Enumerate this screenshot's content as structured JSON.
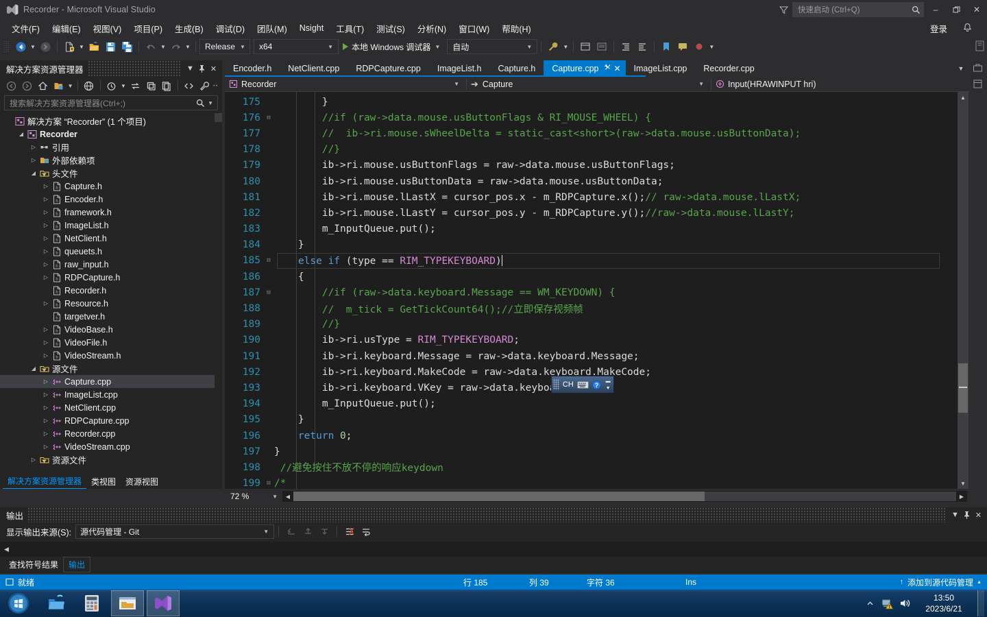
{
  "window": {
    "title": "Recorder - Microsoft Visual Studio",
    "logo_icon": "visual-studio-logo",
    "minimize": "–",
    "maximize": "❐",
    "close": "✕",
    "filter_icon": "filter-icon"
  },
  "quick_launch": {
    "placeholder": "快速启动 (Ctrl+Q)",
    "search_icon": "search-icon"
  },
  "menu": {
    "items": [
      "文件(F)",
      "编辑(E)",
      "视图(V)",
      "项目(P)",
      "生成(B)",
      "调试(D)",
      "团队(M)",
      "Nsight",
      "工具(T)",
      "测试(S)",
      "分析(N)",
      "窗口(W)",
      "帮助(H)"
    ],
    "signin": "登录",
    "notification_icon": "bell-icon"
  },
  "toolbar": {
    "nav_back_icon": "navigate-back-icon",
    "nav_forward_icon": "navigate-forward-icon",
    "new_item_icon": "new-item-icon",
    "open_icon": "open-folder-icon",
    "save_icon": "save-icon",
    "save_all_icon": "save-all-icon",
    "undo_icon": "undo-icon",
    "redo_icon": "redo-icon",
    "configuration": "Release",
    "platform": "x64",
    "run_label": "本地 Windows 调试器",
    "run_icon": "play-icon",
    "auto": "自动",
    "extra_icons": [
      "wrench-icon",
      "layout-icon",
      "list-icon",
      "indent-icon",
      "outdent-icon",
      "comment-icon",
      "bookmark-icon",
      "breakpoint-icon"
    ]
  },
  "solution_explorer": {
    "title": "解决方案资源管理器",
    "caret_icon": "chevron-down-icon",
    "pin_icon": "pin-icon",
    "close_icon": "close-icon",
    "toolbar_icons": [
      "back-icon",
      "forward-icon",
      "home-icon",
      "pending-changes-icon",
      "sync-icon",
      "refresh-icon",
      "collapse-all-icon",
      "properties-icon",
      "show-all-files-icon",
      "code-view-icon",
      "wrench-icon"
    ],
    "search_placeholder": "搜索解决方案资源管理器(Ctrl+;)",
    "search_icon": "search-icon",
    "tree": [
      {
        "label": "解决方案 “Recorder” (1 个项目)",
        "indent": 0,
        "expander": "",
        "icon": "solution-icon",
        "bold": false,
        "selected": false
      },
      {
        "label": "Recorder",
        "indent": 1,
        "expander": "◢",
        "icon": "project-icon",
        "bold": true,
        "selected": false
      },
      {
        "label": "引用",
        "indent": 2,
        "expander": "▷",
        "icon": "references-icon",
        "bold": false,
        "selected": false
      },
      {
        "label": "外部依赖项",
        "indent": 2,
        "expander": "▷",
        "icon": "folder-icon",
        "bold": false,
        "selected": false
      },
      {
        "label": "头文件",
        "indent": 2,
        "expander": "◢",
        "icon": "filter-folder-icon",
        "bold": false,
        "selected": false
      },
      {
        "label": "Capture.h",
        "indent": 3,
        "expander": "▷",
        "icon": "header-file-icon",
        "bold": false,
        "selected": false
      },
      {
        "label": "Encoder.h",
        "indent": 3,
        "expander": "▷",
        "icon": "header-file-icon",
        "bold": false,
        "selected": false
      },
      {
        "label": "framework.h",
        "indent": 3,
        "expander": "▷",
        "icon": "header-file-icon",
        "bold": false,
        "selected": false
      },
      {
        "label": "ImageList.h",
        "indent": 3,
        "expander": "▷",
        "icon": "header-file-icon",
        "bold": false,
        "selected": false
      },
      {
        "label": "NetClient.h",
        "indent": 3,
        "expander": "▷",
        "icon": "header-file-icon",
        "bold": false,
        "selected": false
      },
      {
        "label": "queuets.h",
        "indent": 3,
        "expander": "▷",
        "icon": "header-file-icon",
        "bold": false,
        "selected": false
      },
      {
        "label": "raw_input.h",
        "indent": 3,
        "expander": "▷",
        "icon": "header-file-icon",
        "bold": false,
        "selected": false
      },
      {
        "label": "RDPCapture.h",
        "indent": 3,
        "expander": "▷",
        "icon": "header-file-icon",
        "bold": false,
        "selected": false
      },
      {
        "label": "Recorder.h",
        "indent": 3,
        "expander": "",
        "icon": "header-file-icon",
        "bold": false,
        "selected": false
      },
      {
        "label": "Resource.h",
        "indent": 3,
        "expander": "▷",
        "icon": "header-file-icon",
        "bold": false,
        "selected": false
      },
      {
        "label": "targetver.h",
        "indent": 3,
        "expander": "",
        "icon": "header-file-icon",
        "bold": false,
        "selected": false
      },
      {
        "label": "VideoBase.h",
        "indent": 3,
        "expander": "▷",
        "icon": "header-file-icon",
        "bold": false,
        "selected": false
      },
      {
        "label": "VideoFile.h",
        "indent": 3,
        "expander": "▷",
        "icon": "header-file-icon",
        "bold": false,
        "selected": false
      },
      {
        "label": "VideoStream.h",
        "indent": 3,
        "expander": "▷",
        "icon": "header-file-icon",
        "bold": false,
        "selected": false
      },
      {
        "label": "源文件",
        "indent": 2,
        "expander": "◢",
        "icon": "filter-folder-icon",
        "bold": false,
        "selected": false
      },
      {
        "label": "Capture.cpp",
        "indent": 3,
        "expander": "▷",
        "icon": "cpp-file-icon",
        "bold": false,
        "selected": true
      },
      {
        "label": "ImageList.cpp",
        "indent": 3,
        "expander": "▷",
        "icon": "cpp-file-icon",
        "bold": false,
        "selected": false
      },
      {
        "label": "NetClient.cpp",
        "indent": 3,
        "expander": "▷",
        "icon": "cpp-file-icon",
        "bold": false,
        "selected": false
      },
      {
        "label": "RDPCapture.cpp",
        "indent": 3,
        "expander": "▷",
        "icon": "cpp-file-icon",
        "bold": false,
        "selected": false
      },
      {
        "label": "Recorder.cpp",
        "indent": 3,
        "expander": "▷",
        "icon": "cpp-file-icon",
        "bold": false,
        "selected": false
      },
      {
        "label": "VideoStream.cpp",
        "indent": 3,
        "expander": "▷",
        "icon": "cpp-file-icon",
        "bold": false,
        "selected": false
      },
      {
        "label": "资源文件",
        "indent": 2,
        "expander": "▷",
        "icon": "filter-folder-icon",
        "bold": false,
        "selected": false
      }
    ],
    "bottom_tabs": [
      {
        "label": "解决方案资源管理器",
        "active": true
      },
      {
        "label": "类视图",
        "active": false
      },
      {
        "label": "资源视图",
        "active": false
      }
    ]
  },
  "editor": {
    "tabs": [
      {
        "label": "Encoder.h",
        "active": false
      },
      {
        "label": "NetClient.cpp",
        "active": false
      },
      {
        "label": "RDPCapture.cpp",
        "active": false
      },
      {
        "label": "ImageList.h",
        "active": false
      },
      {
        "label": "Capture.h",
        "active": false
      },
      {
        "label": "Capture.cpp",
        "active": true
      },
      {
        "label": "ImageList.cpp",
        "active": false
      },
      {
        "label": "Recorder.cpp",
        "active": false
      }
    ],
    "tab_pin_icon": "pin-icon",
    "tab_close_icon": "close-icon",
    "tab_overflow_icon": "chevron-down-icon",
    "nav": {
      "project": "Recorder",
      "project_icon": "project-icon",
      "class": "Capture",
      "class_icon": "class-arrow-icon",
      "member": "Input(HRAWINPUT hri)",
      "member_icon": "method-icon",
      "caret_icon": "chevron-down-icon"
    },
    "zoom": "72 %",
    "zoom_caret_icon": "chevron-down-icon",
    "lines": [
      {
        "n": "175",
        "fold": "",
        "cur": false,
        "parts": [
          {
            "t": "        }",
            "c": ""
          }
        ]
      },
      {
        "n": "176",
        "fold": "⊟",
        "cur": false,
        "parts": [
          {
            "t": "        //if (raw->data.mouse.usButtonFlags & RI_MOUSE_WHEEL) {",
            "c": "cm"
          }
        ]
      },
      {
        "n": "177",
        "fold": "",
        "cur": false,
        "parts": [
          {
            "t": "        //  ib->ri.mouse.sWheelDelta = static_cast<short>(raw->data.mouse.usButtonData);",
            "c": "cm"
          }
        ]
      },
      {
        "n": "178",
        "fold": "",
        "cur": false,
        "parts": [
          {
            "t": "        //}",
            "c": "cm"
          }
        ]
      },
      {
        "n": "179",
        "fold": "",
        "cur": false,
        "parts": [
          {
            "t": "        ib->ri.mouse.usButtonFlags = raw->data.mouse.usButtonFlags;",
            "c": ""
          }
        ]
      },
      {
        "n": "180",
        "fold": "",
        "cur": false,
        "parts": [
          {
            "t": "        ib->ri.mouse.usButtonData = raw->data.mouse.usButtonData;",
            "c": ""
          }
        ]
      },
      {
        "n": "181",
        "fold": "",
        "cur": false,
        "parts": [
          {
            "t": "        ib->ri.mouse.lLastX = cursor_pos.x - m_RDPCapture.x();",
            "c": ""
          },
          {
            "t": "// raw->data.mouse.lLastX;",
            "c": "cm"
          }
        ]
      },
      {
        "n": "182",
        "fold": "",
        "cur": false,
        "parts": [
          {
            "t": "        ib->ri.mouse.lLastY = cursor_pos.y - m_RDPCapture.y();",
            "c": ""
          },
          {
            "t": "//raw->data.mouse.lLastY;",
            "c": "cm"
          }
        ]
      },
      {
        "n": "183",
        "fold": "",
        "cur": false,
        "parts": [
          {
            "t": "        m_InputQueue.put();",
            "c": ""
          }
        ]
      },
      {
        "n": "184",
        "fold": "",
        "cur": false,
        "parts": [
          {
            "t": "    }",
            "c": ""
          }
        ]
      },
      {
        "n": "185",
        "fold": "⊟",
        "cur": true,
        "parts": [
          {
            "t": "    ",
            "c": ""
          },
          {
            "t": "else if",
            "c": "kw"
          },
          {
            "t": " (type == ",
            "c": ""
          },
          {
            "t": "RIM_TYPEKEYBOARD",
            "c": "mac"
          },
          {
            "t": ")",
            "c": ""
          }
        ]
      },
      {
        "n": "186",
        "fold": "",
        "cur": false,
        "parts": [
          {
            "t": "    {",
            "c": ""
          }
        ]
      },
      {
        "n": "187",
        "fold": "⊟",
        "cur": false,
        "parts": [
          {
            "t": "        //if (raw->data.keyboard.Message == WM_KEYDOWN) {",
            "c": "cm"
          }
        ]
      },
      {
        "n": "188",
        "fold": "",
        "cur": false,
        "parts": [
          {
            "t": "        //  m_tick = GetTickCount64();//立即保存视频帧",
            "c": "cm"
          }
        ]
      },
      {
        "n": "189",
        "fold": "",
        "cur": false,
        "parts": [
          {
            "t": "        //}",
            "c": "cm"
          }
        ]
      },
      {
        "n": "190",
        "fold": "",
        "cur": false,
        "parts": [
          {
            "t": "        ib->ri.usType = ",
            "c": ""
          },
          {
            "t": "RIM_TYPEKEYBOARD",
            "c": "mac"
          },
          {
            "t": ";",
            "c": ""
          }
        ]
      },
      {
        "n": "191",
        "fold": "",
        "cur": false,
        "parts": [
          {
            "t": "        ib->ri.keyboard.Message = raw->data.keyboard.Message;",
            "c": ""
          }
        ]
      },
      {
        "n": "192",
        "fold": "",
        "cur": false,
        "parts": [
          {
            "t": "        ib->ri.keyboard.MakeCode = raw->data.keyboard.MakeCode;",
            "c": ""
          }
        ]
      },
      {
        "n": "193",
        "fold": "",
        "cur": false,
        "parts": [
          {
            "t": "        ib->ri.keyboard.VKey = raw->data.keyboard.VKey;",
            "c": ""
          }
        ]
      },
      {
        "n": "194",
        "fold": "",
        "cur": false,
        "parts": [
          {
            "t": "        m_InputQueue.put();",
            "c": ""
          }
        ]
      },
      {
        "n": "195",
        "fold": "",
        "cur": false,
        "parts": [
          {
            "t": "    }",
            "c": ""
          }
        ]
      },
      {
        "n": "196",
        "fold": "",
        "cur": false,
        "parts": [
          {
            "t": "    ",
            "c": ""
          },
          {
            "t": "return",
            "c": "kw"
          },
          {
            "t": " ",
            "c": ""
          },
          {
            "t": "0",
            "c": "num"
          },
          {
            "t": ";",
            "c": ""
          }
        ]
      },
      {
        "n": "197",
        "fold": "",
        "cur": false,
        "parts": [
          {
            "t": "}",
            "c": ""
          }
        ]
      },
      {
        "n": "198",
        "fold": "",
        "cur": false,
        "parts": [
          {
            "t": " //避免按住不放不停的响应keydown",
            "c": "cm"
          }
        ]
      },
      {
        "n": "199",
        "fold": "⊟",
        "cur": false,
        "parts": [
          {
            "t": "/*",
            "c": "cm"
          }
        ]
      }
    ]
  },
  "ime": {
    "language": "CH",
    "grip_icon": "drag-grip-icon",
    "keyboard_icon": "keyboard-icon",
    "help_icon": "help-icon",
    "minimize_icon": "ime-minimize-icon"
  },
  "output": {
    "title": "输出",
    "caret_icon": "chevron-down-icon",
    "pin_icon": "pin-icon",
    "close_icon": "close-icon",
    "source_label": "显示输出来源(S):",
    "source_value": "源代码管理 - Git",
    "toolbar_icons": [
      "jump-to-prev-icon",
      "navigate-up-icon",
      "navigate-down-icon",
      "clear-all-icon",
      "word-wrap-icon"
    ],
    "tabs": [
      {
        "label": "查找符号结果",
        "active": false
      },
      {
        "label": "输出",
        "active": true
      }
    ]
  },
  "status_bar": {
    "ready": "就绪",
    "ready_icon": "status-icon",
    "line_label": "行 185",
    "col_label": "列 39",
    "char_label": "字符 36",
    "insert_mode": "Ins",
    "source_control": "添加到源代码管理",
    "source_control_icon": "arrow-up-icon",
    "source_control_caret": "▲"
  },
  "taskbar": {
    "start_icon": "windows-start-orb",
    "items": [
      {
        "icon": "explorer-pin-icon",
        "active": false
      },
      {
        "icon": "calculator-icon",
        "active": false
      },
      {
        "icon": "folder-window-icon",
        "active": true
      },
      {
        "icon": "visual-studio-icon",
        "active": true
      }
    ],
    "tray": {
      "show_hidden_icon": "chevron-up-icon",
      "network_icon": "network-warning-icon",
      "volume_icon": "volume-icon",
      "time": "13:50",
      "date": "2023/6/21"
    }
  },
  "colors": {
    "accent": "#007acc",
    "chrome": "#2d2d30",
    "panel": "#252526",
    "editor_bg": "#1e1e1e",
    "comment": "#57a64a",
    "keyword": "#569cd6",
    "macro": "#d689d6",
    "line_number": "#2b91af"
  }
}
